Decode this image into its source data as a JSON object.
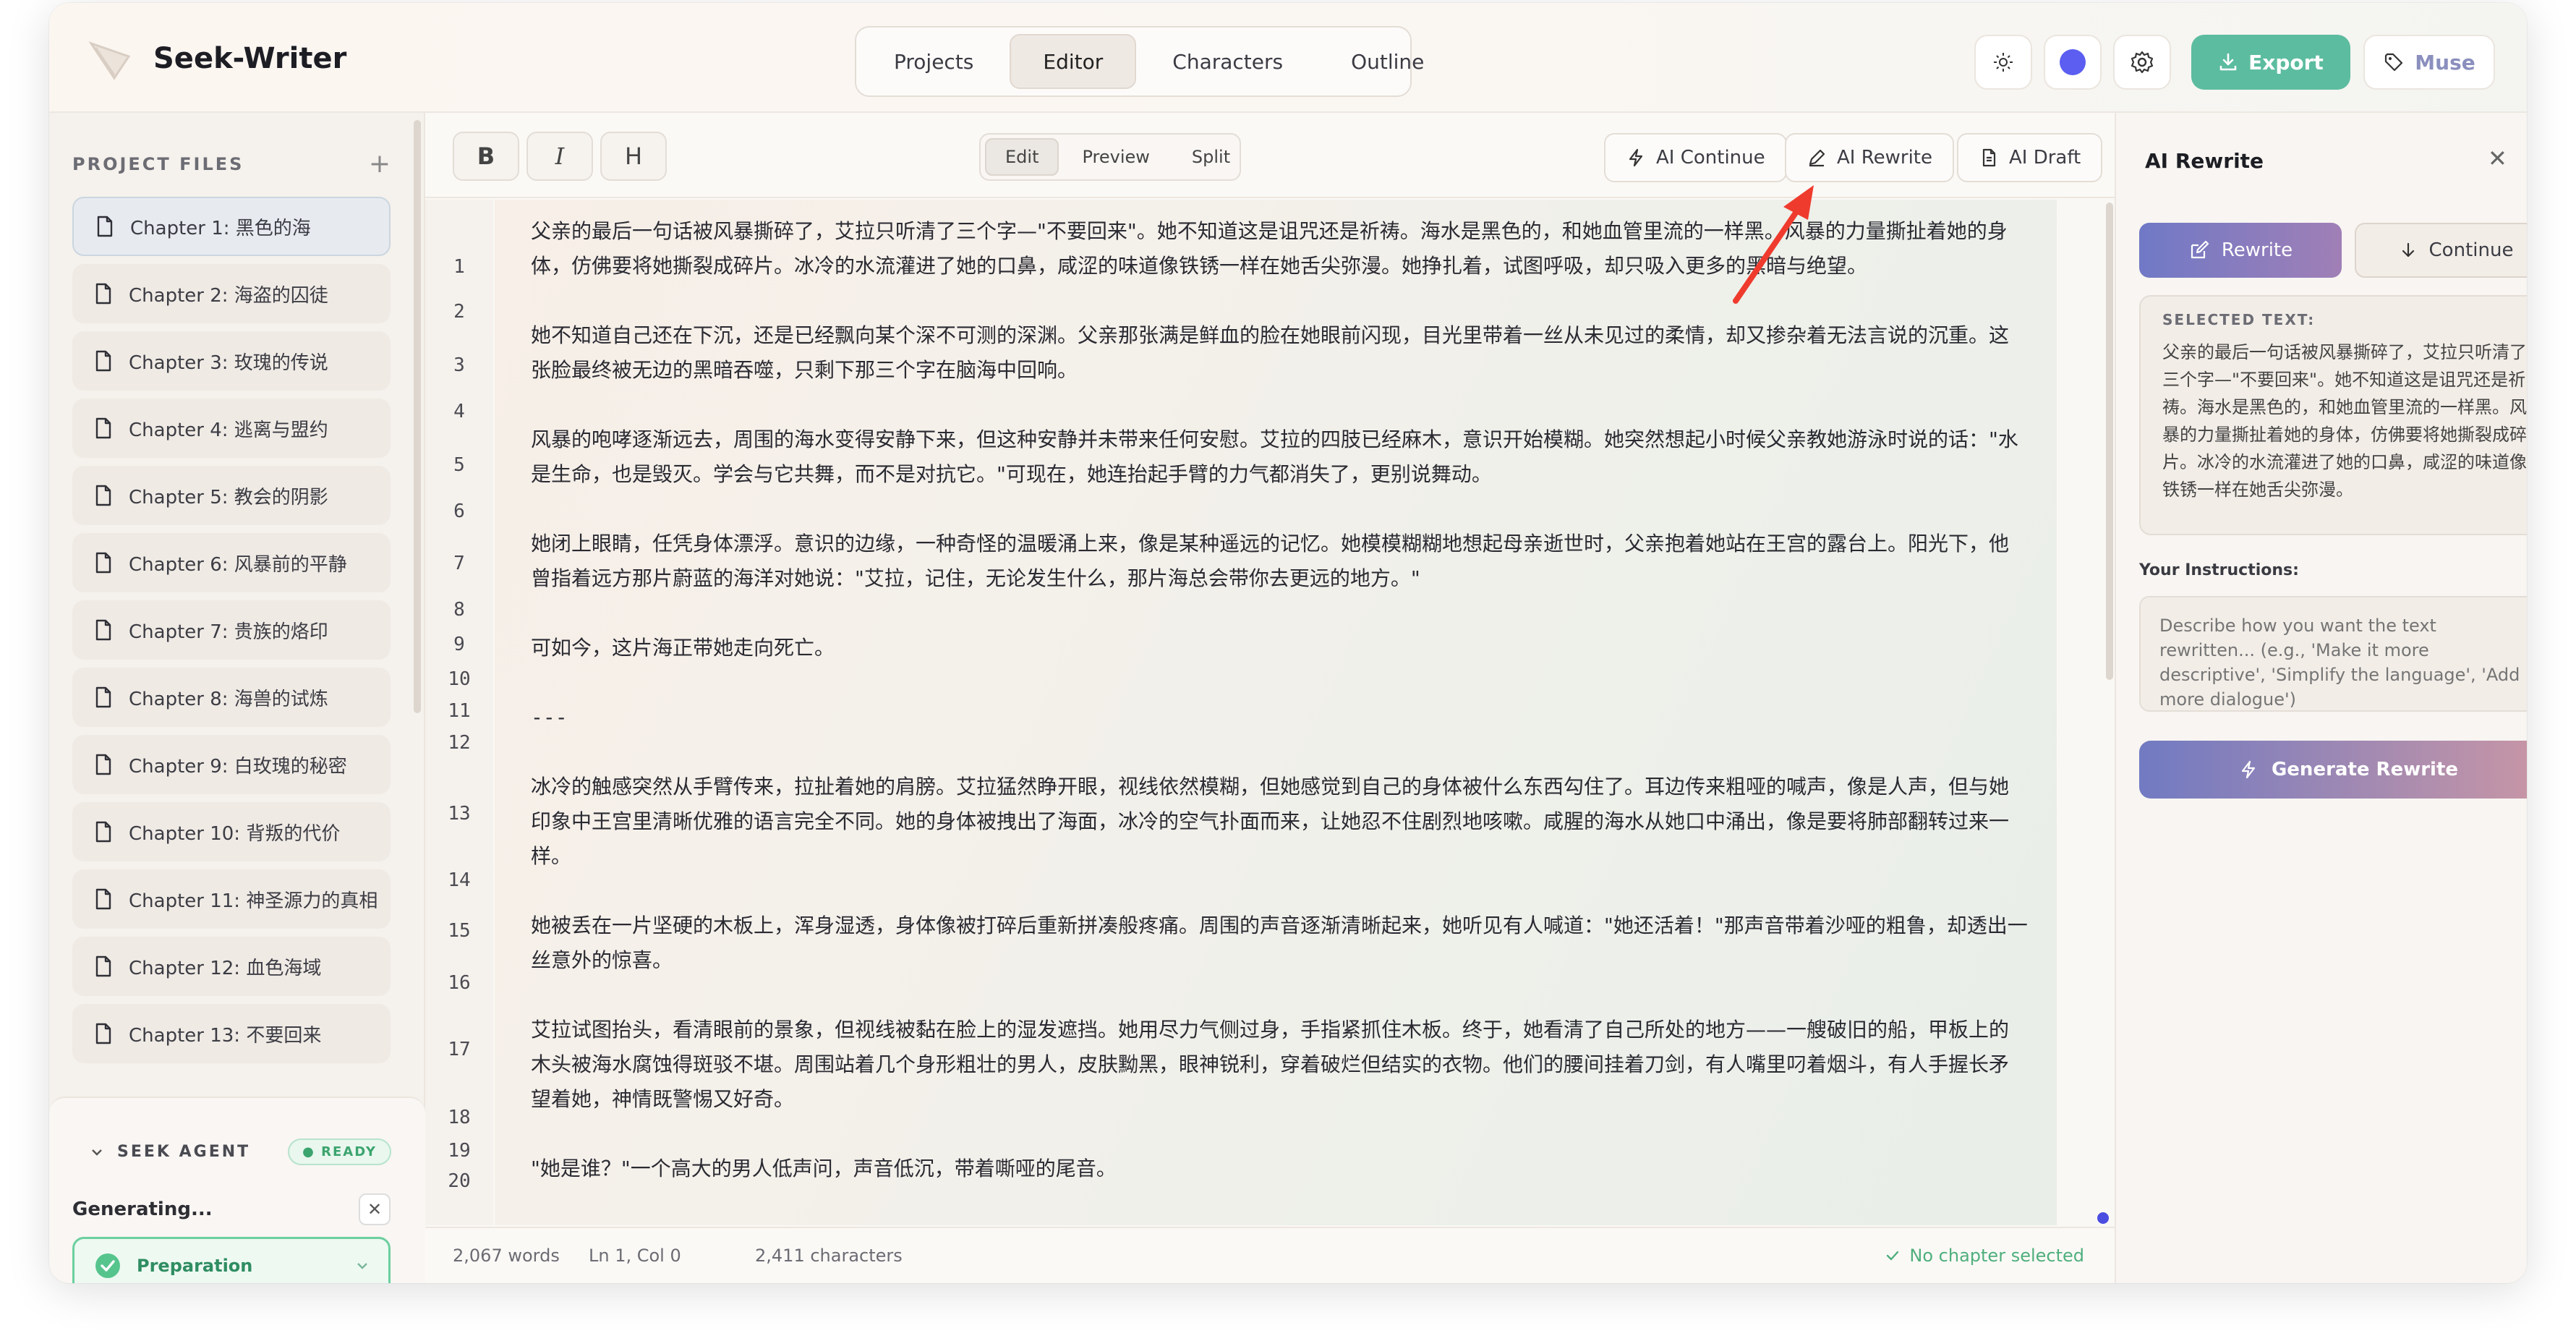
{
  "app": {
    "title": "Seek-Writer"
  },
  "header": {
    "tabs": [
      {
        "label": "Projects",
        "active": false
      },
      {
        "label": "Editor",
        "active": true
      },
      {
        "label": "Characters",
        "active": false
      },
      {
        "label": "Outline",
        "active": false
      }
    ],
    "icons": [
      "sun-icon",
      "theme-color-dot",
      "settings-icon"
    ],
    "export_label": "Export",
    "muse_label": "Muse",
    "accent_color": "#5cbc9f"
  },
  "sidebar": {
    "title": "PROJECT FILES",
    "chapters": [
      {
        "label": "Chapter 1: 黑色的海",
        "active": true
      },
      {
        "label": "Chapter 2: 海盗的囚徒"
      },
      {
        "label": "Chapter 3: 玫瑰的传说"
      },
      {
        "label": "Chapter 4: 逃离与盟约"
      },
      {
        "label": "Chapter 5: 教会的阴影"
      },
      {
        "label": "Chapter 6: 风暴前的平静"
      },
      {
        "label": "Chapter 7: 贵族的烙印"
      },
      {
        "label": "Chapter 8: 海兽的试炼"
      },
      {
        "label": "Chapter 9: 白玫瑰的秘密"
      },
      {
        "label": "Chapter 10: 背叛的代价"
      },
      {
        "label": "Chapter 11: 神圣源力的真相"
      },
      {
        "label": "Chapter 12: 血色海域"
      },
      {
        "label": "Chapter 13: 不要回来"
      }
    ],
    "agent": {
      "title": "SEEK AGENT",
      "status": "READY",
      "generating": "Generating...",
      "step": "Preparation"
    }
  },
  "editor": {
    "format_buttons": [
      "B",
      "I",
      "H"
    ],
    "modes": [
      {
        "label": "Edit",
        "active": true
      },
      {
        "label": "Preview",
        "active": false
      },
      {
        "label": "Split",
        "active": false
      }
    ],
    "ai_continue": "AI Continue",
    "ai_rewrite": "AI Rewrite",
    "ai_draft": "AI Draft",
    "line_numbers": [
      "1",
      "2",
      "3",
      "4",
      "5",
      "6",
      "7",
      "8",
      "9",
      "10",
      "11",
      "12",
      "13",
      "14",
      "15",
      "16",
      "17",
      "18",
      "19",
      "20"
    ],
    "paragraphs": [
      "父亲的最后一句话被风暴撕碎了，艾拉只听清了三个字—\"不要回来\"。她不知道这是诅咒还是祈祷。海水是黑色的，和她血管里流的一样黑。风暴的力量撕扯着她的身体，仿佛要将她撕裂成碎片。冰冷的水流灌进了她的口鼻，咸涩的味道像铁锈一样在她舌尖弥漫。她挣扎着，试图呼吸，却只吸入更多的黑暗与绝望。",
      "她不知道自己还在下沉，还是已经飘向某个深不可测的深渊。父亲那张满是鲜血的脸在她眼前闪现，目光里带着一丝从未见过的柔情，却又掺杂着无法言说的沉重。这张脸最终被无边的黑暗吞噬，只剩下那三个字在脑海中回响。",
      "风暴的咆哮逐渐远去，周围的海水变得安静下来，但这种安静并未带来任何安慰。艾拉的四肢已经麻木，意识开始模糊。她突然想起小时候父亲教她游泳时说的话：\"水是生命，也是毁灭。学会与它共舞，而不是对抗它。\"可现在，她连抬起手臂的力气都消失了，更别说舞动。",
      "她闭上眼睛，任凭身体漂浮。意识的边缘，一种奇怪的温暖涌上来，像是某种遥远的记忆。她模模糊糊地想起母亲逝世时，父亲抱着她站在王宫的露台上。阳光下，他曾指着远方那片蔚蓝的海洋对她说：\"艾拉，记住，无论发生什么，那片海总会带你去更远的地方。\"",
      "可如今，这片海正带她走向死亡。",
      "---",
      "冰冷的触感突然从手臂传来，拉扯着她的肩膀。艾拉猛然睁开眼，视线依然模糊，但她感觉到自己的身体被什么东西勾住了。耳边传来粗哑的喊声，像是人声，但与她印象中王宫里清晰优雅的语言完全不同。她的身体被拽出了海面，冰冷的空气扑面而来，让她忍不住剧烈地咳嗽。咸腥的海水从她口中涌出，像是要将肺部翻转过来一样。",
      "她被丢在一片坚硬的木板上，浑身湿透，身体像被打碎后重新拼凑般疼痛。周围的声音逐渐清晰起来，她听见有人喊道：\"她还活着！\"那声音带着沙哑的粗鲁，却透出一丝意外的惊喜。",
      "艾拉试图抬头，看清眼前的景象，但视线被黏在脸上的湿发遮挡。她用尽力气侧过身，手指紧抓住木板。终于，她看清了自己所处的地方——一艘破旧的船，甲板上的木头被海水腐蚀得斑驳不堪。周围站着几个身形粗壮的男人，皮肤黝黑，眼神锐利，穿着破烂但结实的衣物。他们的腰间挂着刀剑，有人嘴里叼着烟斗，有人手握长矛望着她，神情既警惕又好奇。",
      "\"她是谁？\"一个高大的男人低声问，声音低沉，带着嘶哑的尾音。"
    ],
    "status": {
      "words": "2,067 words",
      "position": "Ln 1, Col 0",
      "characters": "2,411 characters",
      "chapter_state": "No chapter selected"
    }
  },
  "rewrite_panel": {
    "title": "AI Rewrite",
    "rewrite_tab": "Rewrite",
    "continue_tab": "Continue",
    "selected_label": "SELECTED TEXT:",
    "selected_text": "父亲的最后一句话被风暴撕碎了，艾拉只听清了三个字—\"不要回来\"。她不知道这是诅咒还是祈祷。海水是黑色的，和她血管里流的一样黑。风暴的力量撕扯着她的身体，仿佛要将她撕裂成碎片。冰冷的水流灌进了她的口鼻，咸涩的味道像铁锈一样在她舌尖弥漫。",
    "instructions_label": "Your Instructions:",
    "instructions_placeholder": "Describe how you want the text rewritten... (e.g., 'Make it more descriptive', 'Simplify the language', 'Add more dialogue')",
    "generate_label": "Generate Rewrite"
  }
}
